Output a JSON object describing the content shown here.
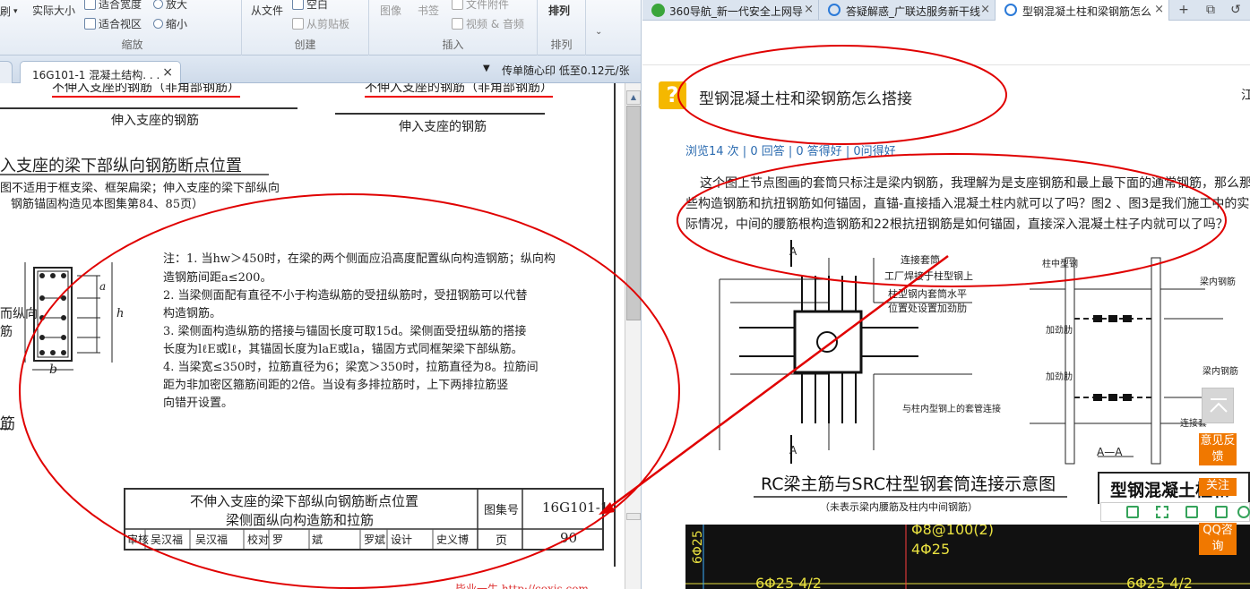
{
  "pdf_viewer": {
    "ribbon": {
      "zoom_group": {
        "title": "缩放",
        "actual_size": "实际大小",
        "fit_width": "适合宽度",
        "fit_view": "适合视区",
        "zoom_in": "放大",
        "zoom_out": "缩小"
      },
      "create_group": {
        "title": "创建",
        "from_file": "从文件",
        "blank": "空白",
        "from_clipboard": "从剪贴板"
      },
      "insert_group": {
        "title": "插入",
        "image": "图像",
        "bookmark": "书签",
        "file_attachment": "文件附件",
        "video_audio": "视频 & 音频"
      },
      "arrange_group": {
        "title": "排列",
        "arrange": "排列"
      },
      "left_cut": "刷"
    },
    "doc_tab": {
      "label": "16G101-1 混凝土结构. . .",
      "close": "×"
    },
    "ad": "传单随心印 低至0.12元/张",
    "page": {
      "header_left": "不伸入支座的钢筋（非角部钢筋）",
      "header_right": "不伸入支座的钢筋（非角部钢筋）",
      "label_left": "伸入支座的钢筋",
      "label_right": "伸入支座的钢筋",
      "section_title": "入支座的梁下部纵向钢筋断点位置",
      "section_note_1": "图不适用于框支梁、框架扁梁；伸入支座的梁下部纵向",
      "section_note_2": "钢筋锚固构造见本图集第84、85页）",
      "side_label_1": "而纵向",
      "side_label_2": "筋",
      "side_label_3": "筋",
      "dim_label_b": "b",
      "dim_label_hw": "h",
      "dim_label_a": "a",
      "notes": [
        "注：1. 当hw＞450时，在梁的两个侧面应沿高度配置纵向构造钢筋；纵向构",
        "          造钢筋间距a≤200。",
        "       2. 当梁侧面配有直径不小于构造纵筋的受扭纵筋时，受扭钢筋可以代替",
        "          构造钢筋。",
        "       3. 梁侧面构造纵筋的搭接与锚固长度可取15d。梁侧面受扭纵筋的搭接",
        "          长度为lℓE或lℓ，其锚固长度为laE或la，锚固方式同框架梁下部纵筋。",
        "       4. 当梁宽≤350时，拉筋直径为6；梁宽＞350时，拉筋直径为8。拉筋间",
        "          距为非加密区箍筋间距的2倍。当设有多排拉筋时，上下两排拉筋竖",
        "          向错开设置。"
      ],
      "title_block": {
        "title_line_1": "不伸入支座的梁下部纵向钢筋断点位置",
        "title_line_2": "梁侧面纵向构造筋和拉筋",
        "atlas_label": "图集号",
        "atlas_no": "16G101-1",
        "page_label": "页",
        "page_no": "90",
        "sign_row": [
          "审核",
          "吴汉福",
          "吴汉福",
          "校对",
          "罗",
          "斌",
          "罗斌",
          "设计",
          "史义博",
          "史义博"
        ]
      },
      "watermark": "毕业一生 http://coxis.com"
    }
  },
  "browser": {
    "tabs": [
      {
        "title": "360导航_新一代安全上网导",
        "close": "×",
        "favicon": "360-icon"
      },
      {
        "title": "答疑解惑_广联达服务新干线",
        "close": "×",
        "favicon": "ie-icon"
      },
      {
        "title": "型钢混凝土柱和梁钢筋怎么",
        "close": "×",
        "favicon": "ie-icon"
      }
    ],
    "new_tab": "+",
    "tab_list": "⧉",
    "restore": "↺",
    "question": {
      "title": "型钢混凝土柱和梁钢筋怎么搭接",
      "side_char": "江",
      "stats": "浏览14 次 | 0 回答 | 0 答得好 | 0问得好",
      "body": "这个图上节点图画的套筒只标注是梁内钢筋，我理解为是支座钢筋和最上最下面的通常钢筋，那么那些构造钢筋和抗扭钢筋如何锚固，直锚-直接插入混凝土柱内就可以了吗？图2 、图3是我们施工中的实际情况，中间的腰筋根构造钢筋和22根抗扭钢筋是如何锚固，直接深入混凝土柱子内就可以了吗？"
    },
    "figure": {
      "caption": "RC梁主筋与SRC柱型钢套筒连接示意图",
      "subcaption": "（未表示梁内腰筋及柱内中间钢筋）",
      "label_A_top": "A",
      "label_A_bottom": "A",
      "label_sleeve": "连接套筒",
      "label_factory": "工厂焊接于柱型钢上",
      "label_stiffener": "柱型钢内套筒水平",
      "label_stiffener_2": "位置处设置加劲肋",
      "label_connect": "与柱内型钢上的套管连接",
      "label_col_steel": "柱中型钢",
      "label_beam_bar": "梁内钢筋",
      "label_jl1": "加劲肋",
      "label_jl2": "加劲肋",
      "label_beam_bar2": "梁内钢筋",
      "label_connect2": "连接套",
      "label_section": "A—A"
    },
    "cad": {
      "t1": "Φ8@100(2)",
      "t2": "4Φ25",
      "t3": "6Φ25",
      "t4": "6Φ25 4/2",
      "t5": "6Φ25 4/2"
    },
    "side_buttons": {
      "feedback": "意见反馈",
      "follow": "关注",
      "qq": "QQ咨询"
    },
    "mini_header": "型钢混凝土柱和"
  },
  "colors": {
    "annotation_red": "#e00000",
    "link_blue": "#2b6bb0",
    "accent_orange": "#f07800",
    "question_yellow": "#f5b800"
  }
}
